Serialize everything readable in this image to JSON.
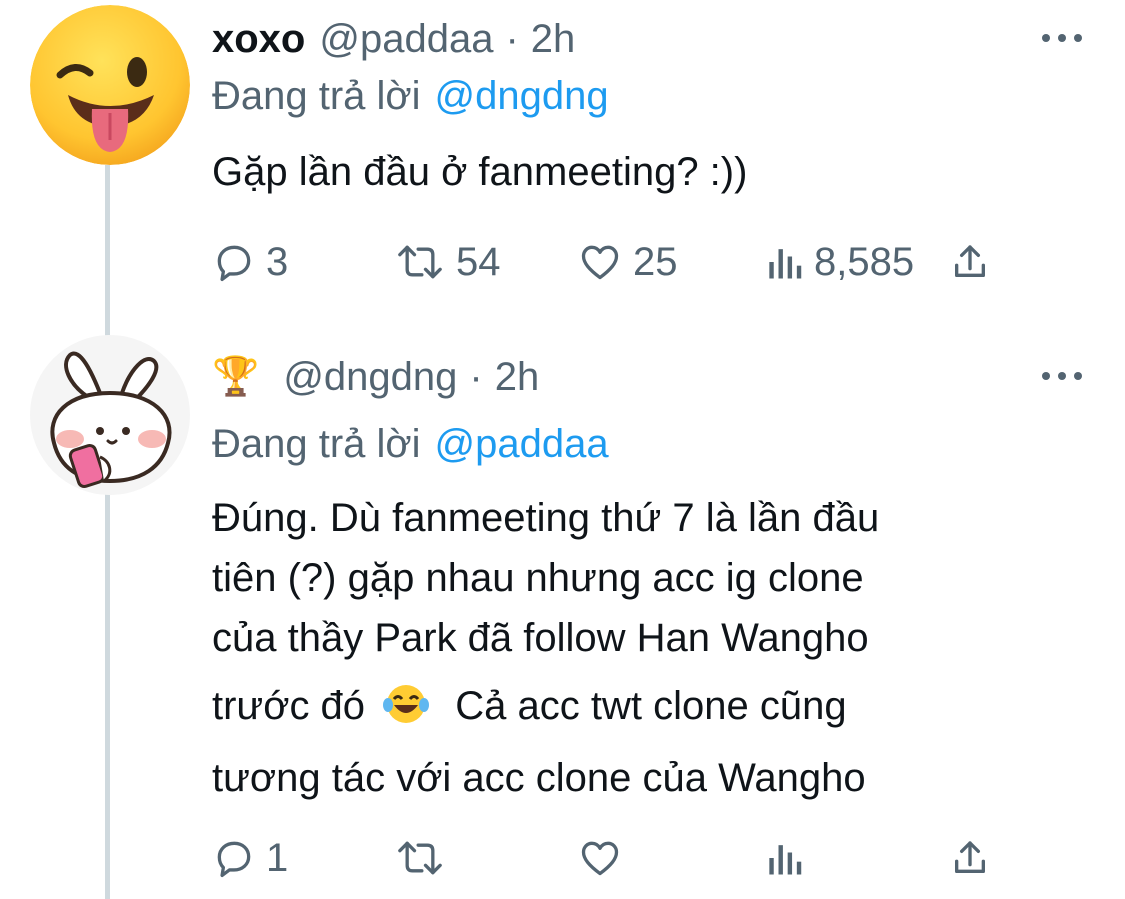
{
  "tweets": [
    {
      "author_name": "xoxo",
      "handle": "@paddaa",
      "separator": "·",
      "time": "2h",
      "replying_label": "Đang trả lời",
      "replying_to": "@dngdng",
      "text": "Gặp lần đầu ở fanmeeting? :))",
      "reply_count": "3",
      "retweet_count": "54",
      "like_count": "25",
      "view_count": "8,585",
      "avatar_icon": "winking-tongue-emoji-icon"
    },
    {
      "author_badge": "🏆",
      "handle": "@dngdng",
      "separator": "·",
      "time": "2h",
      "replying_label": "Đang trả lời",
      "replying_to": "@paddaa",
      "text_lines": [
        "Đúng. Dù fanmeeting thứ 7 là lần đầu",
        "tiên (?) gặp nhau nhưng acc ig clone",
        "của thầy Park đã follow Han Wangho",
        "trước đó",
        "Cả acc twt clone cũng",
        "tương tác với acc clone của Wangho"
      ],
      "inline_emoji": "laughing-tears-emoji-icon",
      "reply_count": "1",
      "avatar_icon": "bunny-sticker-icon"
    }
  ],
  "colors": {
    "primary_text": "#0f1419",
    "secondary_text": "#536471",
    "accent_link": "#1d9bf0",
    "thread_line": "#cfd9de"
  },
  "icons": [
    "reply-icon",
    "retweet-icon",
    "like-icon",
    "views-icon",
    "share-icon",
    "more-options-icon"
  ]
}
